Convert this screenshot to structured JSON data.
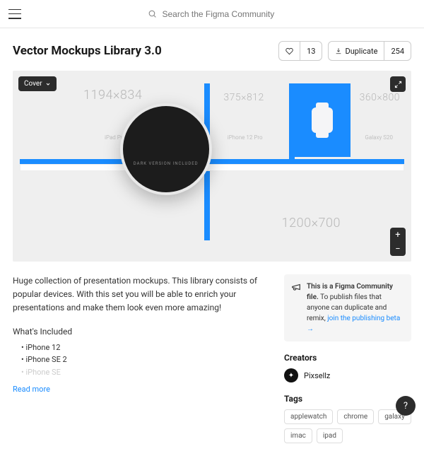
{
  "search": {
    "placeholder": "Search the Figma Community"
  },
  "page": {
    "title": "Vector Mockups Library 3.0",
    "likes": "13",
    "duplicate_label": "Duplicate",
    "duplicate_count": "254"
  },
  "canvas": {
    "cover_label": "Cover",
    "dims": {
      "topleft": "1194×834",
      "topmid": "375×812",
      "topright": "360×800",
      "bottom": "1200×700"
    },
    "devices": {
      "ipad": "iPad Pro",
      "iphone": "iPhone 12 Pro",
      "galaxy": "Galaxy S20",
      "watch": "Apple Watch"
    },
    "lens_text": "DARK VERSION INCLUDED",
    "zoom_in": "+",
    "zoom_out": "−"
  },
  "description": {
    "intro": "Huge collection of presentation mockups. This library consists of popular devices. With this set you will be able to enrich your presentations and make them look even more amazing!",
    "whats_included_heading": "What's Included",
    "items": [
      "iPhone 12",
      "iPhone SE 2",
      "iPhone SE"
    ],
    "read_more": "Read more"
  },
  "sidebar": {
    "notice_bold": "This is a Figma Community file.",
    "notice_rest": " To publish files that anyone can duplicate and remix, ",
    "notice_link": "join the publishing beta →",
    "creators_heading": "Creators",
    "creator_name": "Pixsellz",
    "tags_heading": "Tags",
    "tags": [
      "applewatch",
      "chrome",
      "galaxy",
      "imac",
      "ipad"
    ]
  },
  "help": "?"
}
